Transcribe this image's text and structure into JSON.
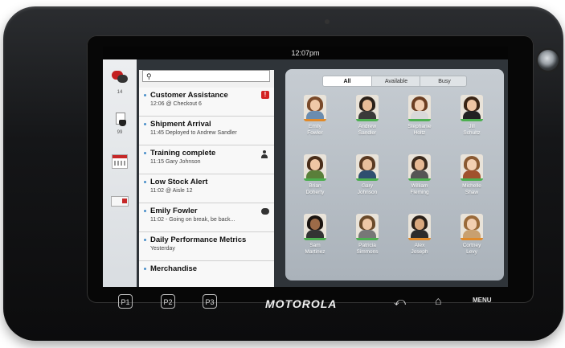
{
  "status_bar": {
    "time": "12:07pm"
  },
  "rail": {
    "items": [
      {
        "icon": "chat-icon",
        "count": "14"
      },
      {
        "icon": "document-icon",
        "count": "99"
      },
      {
        "icon": "calendar-icon",
        "count": ""
      },
      {
        "icon": "card-icon",
        "count": ""
      }
    ]
  },
  "search": {
    "placeholder": ""
  },
  "messages": [
    {
      "title": "Customer Assistance",
      "subtitle": "12:06  @ Checkout 6",
      "badge": "alert",
      "badge_text": "!"
    },
    {
      "title": "Shipment Arrival",
      "subtitle": "11:45 Deployed to Andrew Sandler",
      "badge": "",
      "badge_text": ""
    },
    {
      "title": "Training complete",
      "subtitle": "11:15 Gary Johnson",
      "badge": "person",
      "badge_text": ""
    },
    {
      "title": "Low Stock Alert",
      "subtitle": "11:02  @ Aisle 12",
      "badge": "",
      "badge_text": ""
    },
    {
      "title": "Emily  Fowler",
      "subtitle": "11:02 - Going on break, be back...",
      "badge": "speech",
      "badge_text": ""
    },
    {
      "title": "Daily Performance Metrics",
      "subtitle": "Yesterday",
      "badge": "",
      "badge_text": ""
    },
    {
      "title": "Merchandise",
      "subtitle": "",
      "badge": "",
      "badge_text": ""
    }
  ],
  "filter": {
    "tabs": [
      "All",
      "Available",
      "Busy"
    ],
    "active": "All"
  },
  "contacts": [
    {
      "first": "Emily",
      "last": "Fowler",
      "hair": "#7a4a2a",
      "skin": "#f0c9a8",
      "shirt": "#6b8cae",
      "status": "#e08a2a"
    },
    {
      "first": "Andrew",
      "last": "Sandler",
      "hair": "#2a2018",
      "skin": "#e8bc98",
      "shirt": "#3a3a3a",
      "status": "#4caf50"
    },
    {
      "first": "Stephanie",
      "last": "Holtz",
      "hair": "#6b3e22",
      "skin": "#f1cdb0",
      "shirt": "#d9d9d9",
      "status": "#4caf50"
    },
    {
      "first": "Jill",
      "last": "Schultz",
      "hair": "#3a2414",
      "skin": "#eec4a2",
      "shirt": "#222222",
      "status": "#4caf50"
    },
    {
      "first": "Brian",
      "last": "Doherty",
      "hair": "#4a2e1a",
      "skin": "#efc6a4",
      "shirt": "#5a7f3a",
      "status": "#4caf50"
    },
    {
      "first": "Gary",
      "last": "Johnson",
      "hair": "#5a3a22",
      "skin": "#e9bf9c",
      "shirt": "#2f4f6f",
      "status": "#4caf50"
    },
    {
      "first": "William",
      "last": "Fleming",
      "hair": "#3b2a1c",
      "skin": "#e6b994",
      "shirt": "#555555",
      "status": "#4caf50"
    },
    {
      "first": "Michelle",
      "last": "Shaw",
      "hair": "#8a5a32",
      "skin": "#f3d0b2",
      "shirt": "#a0522d",
      "status": "#4caf50"
    },
    {
      "first": "Sam",
      "last": "Martinez",
      "hair": "#1a1410",
      "skin": "#9c6b48",
      "shirt": "#333333",
      "status": "#4caf50"
    },
    {
      "first": "Patricia",
      "last": "Simmons",
      "hair": "#6a4a2a",
      "skin": "#efc8a6",
      "shirt": "#777777",
      "status": "#4caf50"
    },
    {
      "first": "Alex",
      "last": "Joseph",
      "hair": "#2a2018",
      "skin": "#d9a87e",
      "shirt": "#2c2c2c",
      "status": "#e08a2a"
    },
    {
      "first": "Cortney",
      "last": "Levy",
      "hair": "#9a6a3a",
      "skin": "#f2cfb1",
      "shirt": "#c8a070",
      "status": "#e08a2a"
    }
  ],
  "hardware": {
    "p_buttons": [
      "P1",
      "P2",
      "P3"
    ],
    "brand": "MOTOROLA",
    "menu": "MENU",
    "back_symbol": "⤺",
    "home_symbol": "⌂"
  }
}
